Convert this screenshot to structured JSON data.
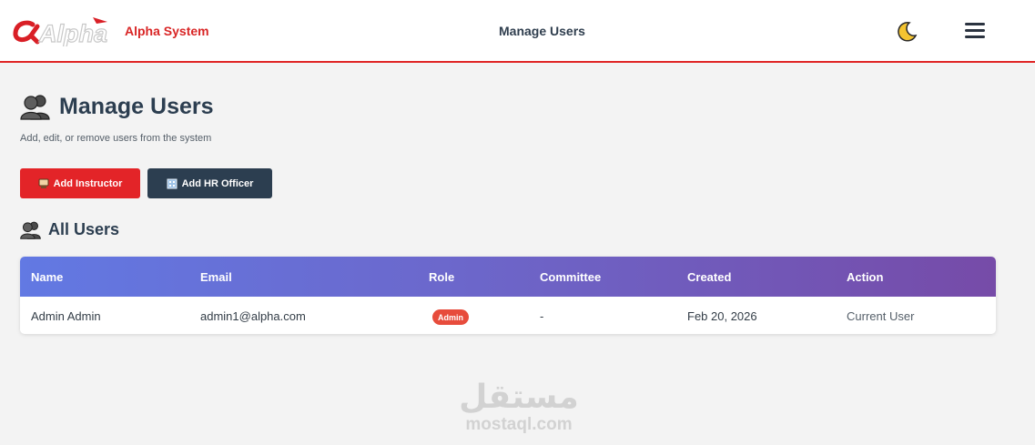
{
  "header": {
    "logo_text": "Alpha",
    "brand": "Alpha System",
    "title": "Manage Users",
    "theme_toggle_icon": "moon-icon",
    "menu_icon": "hamburger-menu-icon"
  },
  "page": {
    "title": "Manage Users",
    "title_icon": "users-icon",
    "subtitle": "Add, edit, or remove users from the system"
  },
  "actions": {
    "add_instructor": {
      "label": "Add Instructor",
      "icon": "teacher-icon"
    },
    "add_hr": {
      "label": "Add HR Officer",
      "icon": "building-icon"
    }
  },
  "section": {
    "title": "All Users",
    "icon": "users-icon"
  },
  "table": {
    "columns": [
      "Name",
      "Email",
      "Role",
      "Committee",
      "Created",
      "Action"
    ],
    "rows": [
      {
        "name": "Admin Admin",
        "email": "admin1@alpha.com",
        "role": "Admin",
        "committee": "-",
        "created": "Feb 20, 2026",
        "action": "Current User"
      }
    ]
  },
  "watermark": {
    "arabic": "مستقل",
    "latin": "mostaql.com"
  },
  "colors": {
    "accent_red": "#e32428",
    "dark_button": "#2c3e50",
    "header_gradient_start": "#6279e3",
    "header_gradient_end": "#764ba8",
    "badge_red": "#e74c3c"
  }
}
